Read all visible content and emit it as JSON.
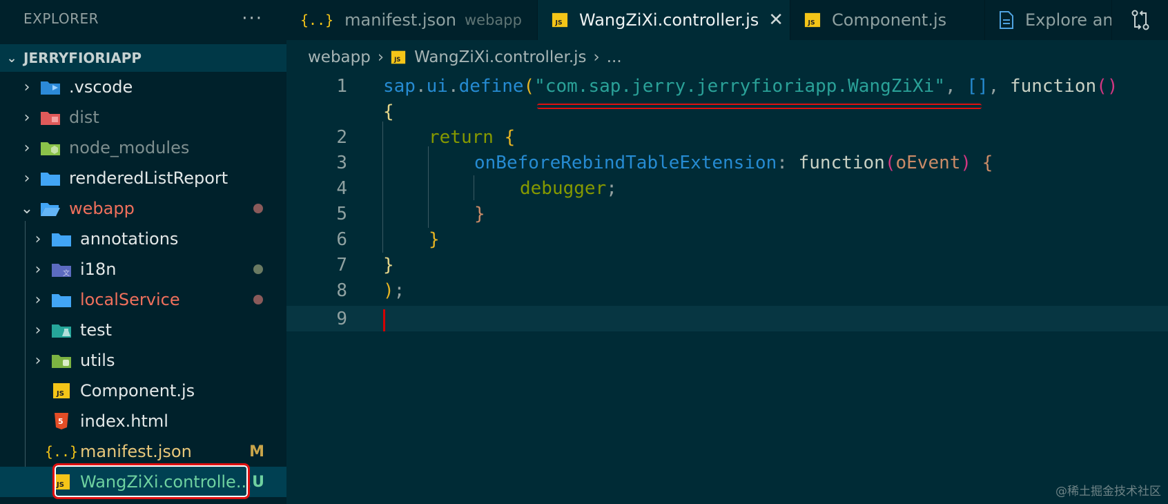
{
  "sidebar": {
    "title": "EXPLORER",
    "more": "···",
    "section": "JERRYFIORIAPP",
    "items": [
      {
        "label": ".vscode",
        "icon": "vscode-folder-icon"
      },
      {
        "label": "dist",
        "icon": "dist-folder-icon"
      },
      {
        "label": "node_modules",
        "icon": "node-folder-icon"
      },
      {
        "label": "renderedListReport",
        "icon": "folder-icon"
      },
      {
        "label": "webapp",
        "icon": "folder-open-icon"
      },
      {
        "label": "annotations",
        "icon": "folder-icon"
      },
      {
        "label": "i18n",
        "icon": "i18n-folder-icon"
      },
      {
        "label": "localService",
        "icon": "folder-icon"
      },
      {
        "label": "test",
        "icon": "test-folder-icon"
      },
      {
        "label": "utils",
        "icon": "utils-folder-icon"
      },
      {
        "label": "Component.js",
        "icon": "js-file-icon"
      },
      {
        "label": "index.html",
        "icon": "html-file-icon"
      },
      {
        "label": "manifest.json",
        "icon": "json-file-icon",
        "badge": "M"
      },
      {
        "label": "WangZiXi.controlle...",
        "icon": "js-file-icon",
        "badge": "U"
      }
    ]
  },
  "tabs": [
    {
      "label": "manifest.json",
      "description": "webapp",
      "icon": "json-file-icon"
    },
    {
      "label": "WangZiXi.controller.js",
      "icon": "js-file-icon",
      "close": "✕"
    },
    {
      "label": "Component.js",
      "icon": "js-file-icon"
    },
    {
      "label": "Explore anc",
      "icon": "preview-file-icon"
    }
  ],
  "breadcrumb": {
    "folder": "webapp",
    "file": "WangZiXi.controller.js",
    "more": "..."
  },
  "code": {
    "line_numbers": [
      "1",
      "",
      "2",
      "3",
      "4",
      "5",
      "6",
      "7",
      "8",
      "9"
    ],
    "l1": {
      "a": "sap",
      "b": ".",
      "c": "ui",
      "d": ".",
      "e": "define",
      "f": "(",
      "g": "\"com.sap.jerry.jerryfioriapp.WangZiXi\"",
      "h": ", ",
      "i": "[]",
      "j": ", ",
      "k": "function",
      "l": "()"
    },
    "l1b": "{",
    "l2": {
      "kw": "return",
      "br": " {"
    },
    "l3": {
      "prop": "onBeforeRebindTableExtension",
      "colon": ": ",
      "fn": "function",
      "po": "(",
      "param": "oEvent",
      "pc": ")",
      "br": " {"
    },
    "l4": {
      "stmt": "debugger",
      "semi": ";"
    },
    "l5": "}",
    "l6": "}",
    "l7": "}",
    "l8": {
      "paren": ")",
      "semi": ";"
    }
  },
  "watermark": "@稀土掘金技术社区",
  "colors": {
    "background": "#002b36",
    "sidebar": "#00212b",
    "accent": "#268bd2",
    "highlight": "#e01010"
  }
}
